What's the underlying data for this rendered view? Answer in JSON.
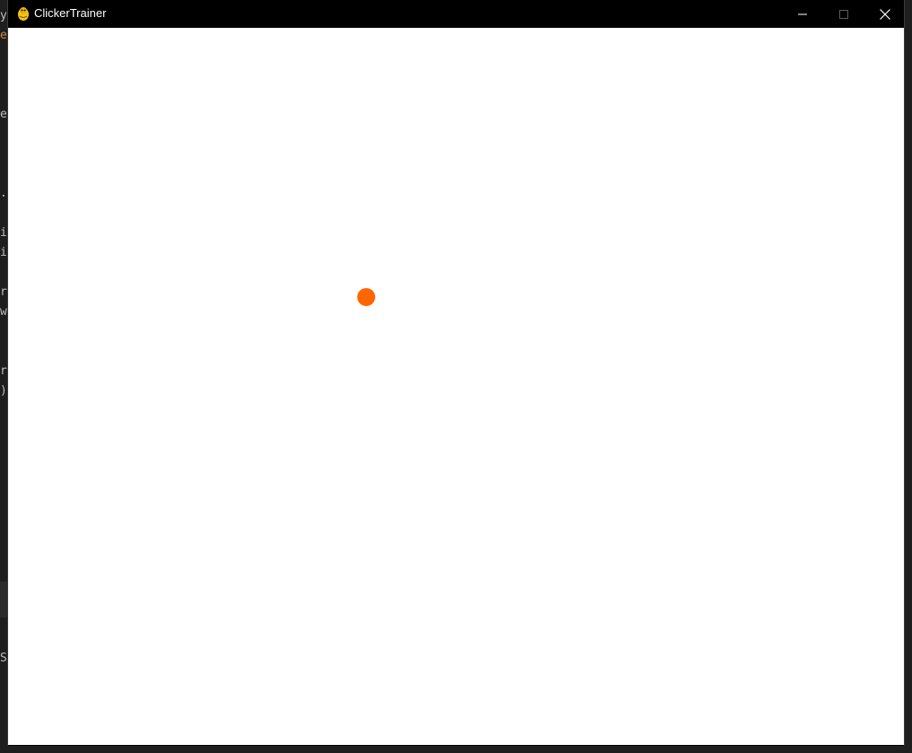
{
  "window": {
    "title": "ClickerTrainer",
    "icon": "pygame-snake-icon"
  },
  "controls": {
    "minimize_icon": "minimize-icon",
    "maximize_icon": "maximize-icon",
    "close_icon": "close-icon"
  },
  "game": {
    "background_color": "#ffffff",
    "target_color": "#ff6600",
    "target_shape": "circle"
  },
  "colors": {
    "titlebar": "#000000",
    "title_text": "#ffffff",
    "behind_window": "#1e1e1e"
  }
}
